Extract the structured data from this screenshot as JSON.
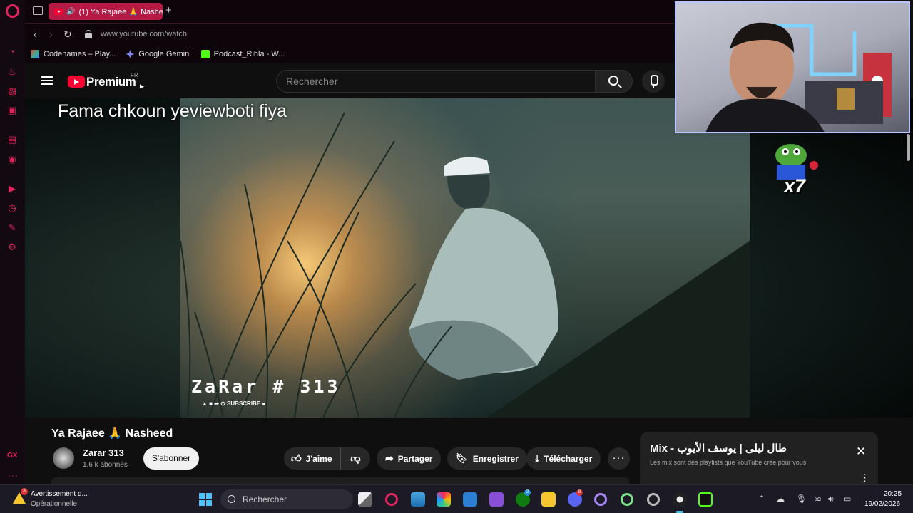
{
  "browser": {
    "tab_title": "(1) Ya Rajaee 🙏 Nashe",
    "url": "www.youtube.com/watch",
    "new_tab": "+",
    "bookmarks": [
      {
        "label": "Codenames – Play..."
      },
      {
        "label": "Google Gemini"
      },
      {
        "label": "Podcast_Rihla - W..."
      }
    ],
    "sidebar_label": "GX",
    "sidebar_more": "···"
  },
  "youtube": {
    "logo_text": "Premium",
    "region": "FR",
    "search_placeholder": "Rechercher"
  },
  "video": {
    "caption": "Fama chkoun yeviewboti fiya",
    "watermark": "ZaRar # 313",
    "subscribe_strip": "▲ ■ ➦ ⊙ SUBSCRIBE ●",
    "emote_count": "x7",
    "title": "Ya Rajaee 🙏 Nasheed"
  },
  "channel": {
    "name": "Zarar 313",
    "subscribers": "1,6 k abonnés",
    "subscribe_label": "S'abonner"
  },
  "actions": {
    "like": "J'aime",
    "share": "Partager",
    "save": "Enregistrer",
    "download": "Télécharger",
    "more": "···"
  },
  "mix": {
    "title": "Mix - طال ليلى | يوسف الأيوب",
    "description": "Les mix sont des playlists que YouTube crée pour vous",
    "close": "✕",
    "menu": "⋮"
  },
  "taskbar": {
    "widget_title": "Avertissement d...",
    "widget_subtitle": "Opérationnelle",
    "widget_badge": "3",
    "search_placeholder": "Rechercher",
    "badges": {
      "xbox": "2",
      "discord": "8"
    },
    "time": "20:25",
    "date": "19/02/2026"
  },
  "colors": {
    "opera_accent": "#e0245e",
    "youtube_red": "#ff0033",
    "windows_accent": "#4cc2ff"
  }
}
